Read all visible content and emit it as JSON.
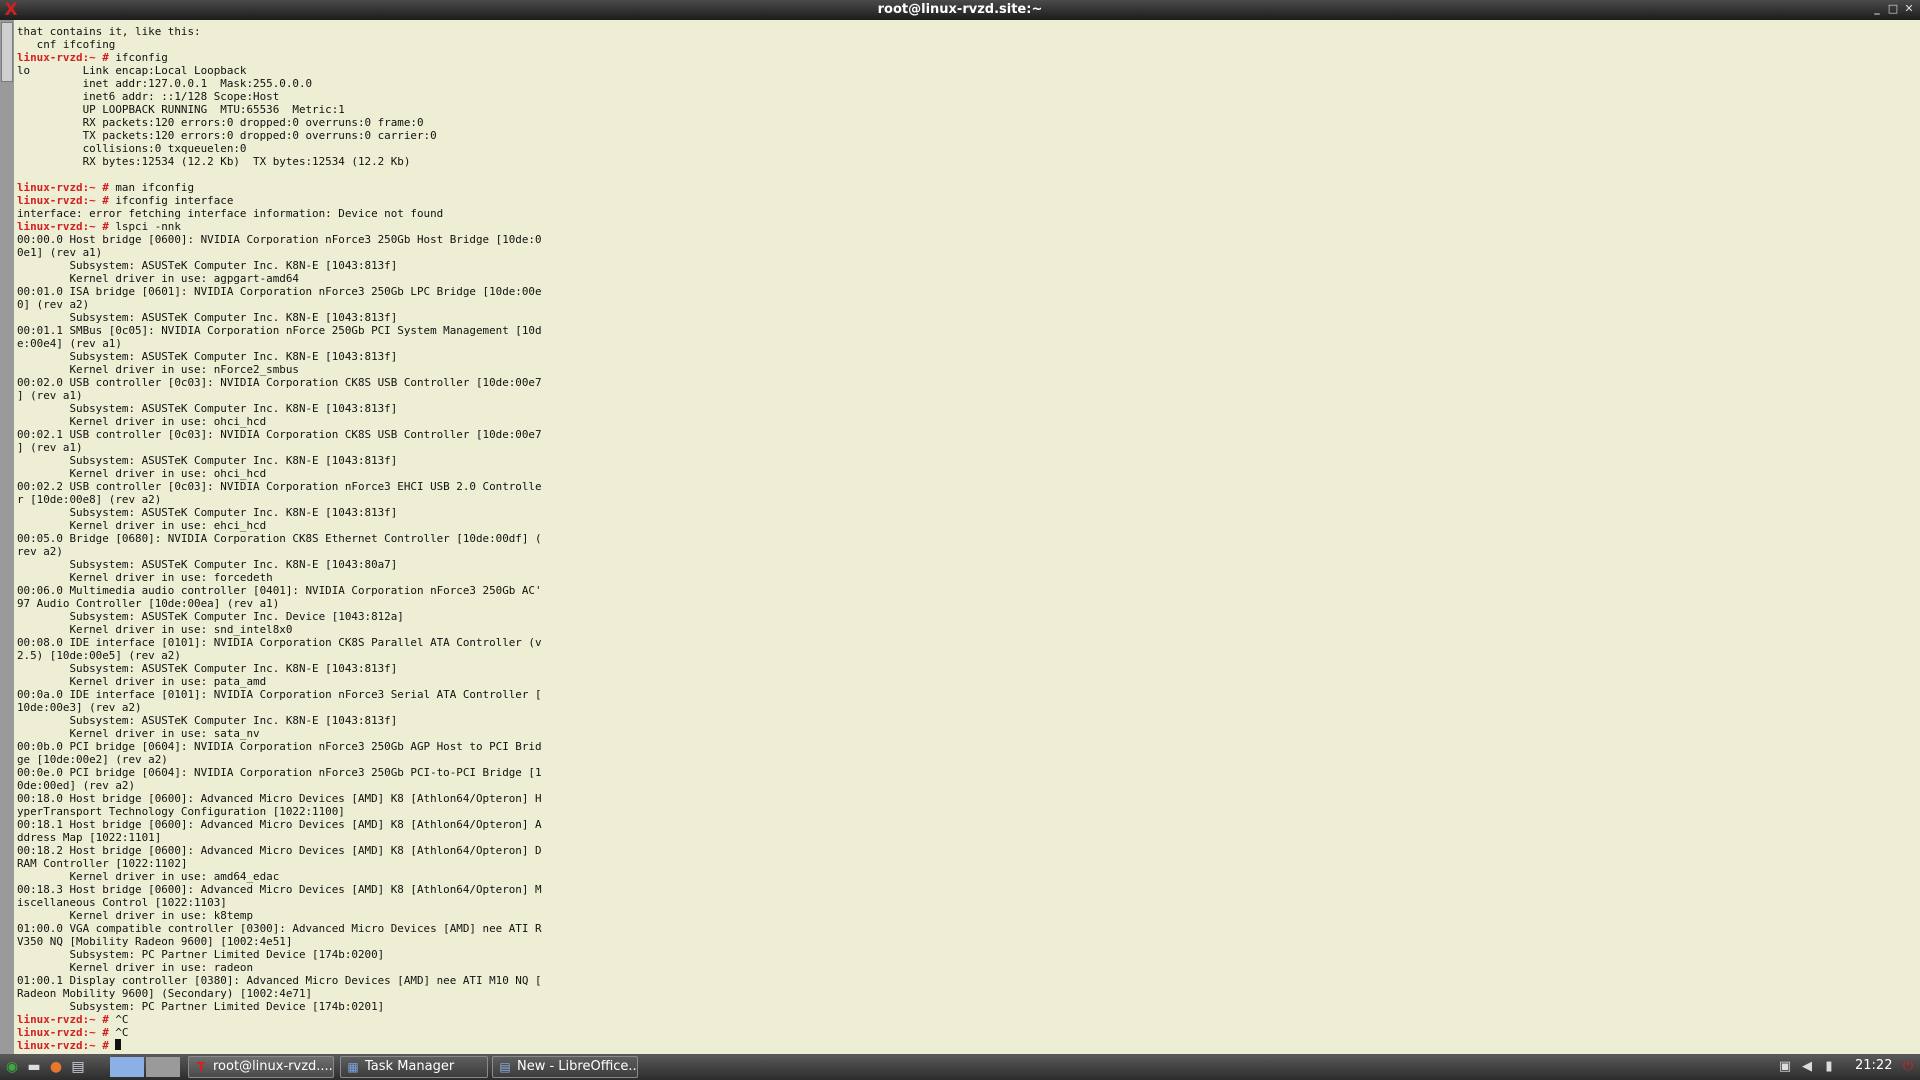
{
  "window": {
    "title": "root@linux-rvzd.site:~",
    "controls": [
      "minimize",
      "maximize",
      "close"
    ]
  },
  "terminal": {
    "lines": [
      {
        "text": "that contains it, like this:"
      },
      {
        "text": "   cnf ifcofing"
      },
      {
        "prompt": "linux-rvzd:~ #",
        "text": " ifconfig"
      },
      {
        "text": "lo        Link encap:Local Loopback"
      },
      {
        "text": "          inet addr:127.0.0.1  Mask:255.0.0.0"
      },
      {
        "text": "          inet6 addr: ::1/128 Scope:Host"
      },
      {
        "text": "          UP LOOPBACK RUNNING  MTU:65536  Metric:1"
      },
      {
        "text": "          RX packets:120 errors:0 dropped:0 overruns:0 frame:0"
      },
      {
        "text": "          TX packets:120 errors:0 dropped:0 overruns:0 carrier:0"
      },
      {
        "text": "          collisions:0 txqueuelen:0"
      },
      {
        "text": "          RX bytes:12534 (12.2 Kb)  TX bytes:12534 (12.2 Kb)"
      },
      {
        "text": ""
      },
      {
        "prompt": "linux-rvzd:~ #",
        "text": " man ifconfig"
      },
      {
        "prompt": "linux-rvzd:~ #",
        "text": " ifconfig interface"
      },
      {
        "text": "interface: error fetching interface information: Device not found"
      },
      {
        "prompt": "linux-rvzd:~ #",
        "text": " lspci -nnk"
      },
      {
        "text": "00:00.0 Host bridge [0600]: NVIDIA Corporation nForce3 250Gb Host Bridge [10de:0"
      },
      {
        "text": "0e1] (rev a1)"
      },
      {
        "text": "        Subsystem: ASUSTeK Computer Inc. K8N-E [1043:813f]"
      },
      {
        "text": "        Kernel driver in use: agpgart-amd64"
      },
      {
        "text": "00:01.0 ISA bridge [0601]: NVIDIA Corporation nForce3 250Gb LPC Bridge [10de:00e"
      },
      {
        "text": "0] (rev a2)"
      },
      {
        "text": "        Subsystem: ASUSTeK Computer Inc. K8N-E [1043:813f]"
      },
      {
        "text": "00:01.1 SMBus [0c05]: NVIDIA Corporation nForce 250Gb PCI System Management [10d"
      },
      {
        "text": "e:00e4] (rev a1)"
      },
      {
        "text": "        Subsystem: ASUSTeK Computer Inc. K8N-E [1043:813f]"
      },
      {
        "text": "        Kernel driver in use: nForce2_smbus"
      },
      {
        "text": "00:02.0 USB controller [0c03]: NVIDIA Corporation CK8S USB Controller [10de:00e7"
      },
      {
        "text": "] (rev a1)"
      },
      {
        "text": "        Subsystem: ASUSTeK Computer Inc. K8N-E [1043:813f]"
      },
      {
        "text": "        Kernel driver in use: ohci_hcd"
      },
      {
        "text": "00:02.1 USB controller [0c03]: NVIDIA Corporation CK8S USB Controller [10de:00e7"
      },
      {
        "text": "] (rev a1)"
      },
      {
        "text": "        Subsystem: ASUSTeK Computer Inc. K8N-E [1043:813f]"
      },
      {
        "text": "        Kernel driver in use: ohci_hcd"
      },
      {
        "text": "00:02.2 USB controller [0c03]: NVIDIA Corporation nForce3 EHCI USB 2.0 Controlle"
      },
      {
        "text": "r [10de:00e8] (rev a2)"
      },
      {
        "text": "        Subsystem: ASUSTeK Computer Inc. K8N-E [1043:813f]"
      },
      {
        "text": "        Kernel driver in use: ehci_hcd"
      },
      {
        "text": "00:05.0 Bridge [0680]: NVIDIA Corporation CK8S Ethernet Controller [10de:00df] ("
      },
      {
        "text": "rev a2)"
      },
      {
        "text": "        Subsystem: ASUSTeK Computer Inc. K8N-E [1043:80a7]"
      },
      {
        "text": "        Kernel driver in use: forcedeth"
      },
      {
        "text": "00:06.0 Multimedia audio controller [0401]: NVIDIA Corporation nForce3 250Gb AC'"
      },
      {
        "text": "97 Audio Controller [10de:00ea] (rev a1)"
      },
      {
        "text": "        Subsystem: ASUSTeK Computer Inc. Device [1043:812a]"
      },
      {
        "text": "        Kernel driver in use: snd_intel8x0"
      },
      {
        "text": "00:08.0 IDE interface [0101]: NVIDIA Corporation CK8S Parallel ATA Controller (v"
      },
      {
        "text": "2.5) [10de:00e5] (rev a2)"
      },
      {
        "text": "        Subsystem: ASUSTeK Computer Inc. K8N-E [1043:813f]"
      },
      {
        "text": "        Kernel driver in use: pata_amd"
      },
      {
        "text": "00:0a.0 IDE interface [0101]: NVIDIA Corporation nForce3 Serial ATA Controller ["
      },
      {
        "text": "10de:00e3] (rev a2)"
      },
      {
        "text": "        Subsystem: ASUSTeK Computer Inc. K8N-E [1043:813f]"
      },
      {
        "text": "        Kernel driver in use: sata_nv"
      },
      {
        "text": "00:0b.0 PCI bridge [0604]: NVIDIA Corporation nForce3 250Gb AGP Host to PCI Brid"
      },
      {
        "text": "ge [10de:00e2] (rev a2)"
      },
      {
        "text": "00:0e.0 PCI bridge [0604]: NVIDIA Corporation nForce3 250Gb PCI-to-PCI Bridge [1"
      },
      {
        "text": "0de:00ed] (rev a2)"
      },
      {
        "text": "00:18.0 Host bridge [0600]: Advanced Micro Devices [AMD] K8 [Athlon64/Opteron] H"
      },
      {
        "text": "yperTransport Technology Configuration [1022:1100]"
      },
      {
        "text": "00:18.1 Host bridge [0600]: Advanced Micro Devices [AMD] K8 [Athlon64/Opteron] A"
      },
      {
        "text": "ddress Map [1022:1101]"
      },
      {
        "text": "00:18.2 Host bridge [0600]: Advanced Micro Devices [AMD] K8 [Athlon64/Opteron] D"
      },
      {
        "text": "RAM Controller [1022:1102]"
      },
      {
        "text": "        Kernel driver in use: amd64_edac"
      },
      {
        "text": "00:18.3 Host bridge [0600]: Advanced Micro Devices [AMD] K8 [Athlon64/Opteron] M"
      },
      {
        "text": "iscellaneous Control [1022:1103]"
      },
      {
        "text": "        Kernel driver in use: k8temp"
      },
      {
        "text": "01:00.0 VGA compatible controller [0300]: Advanced Micro Devices [AMD] nee ATI R"
      },
      {
        "text": "V350 NQ [Mobility Radeon 9600] [1002:4e51]"
      },
      {
        "text": "        Subsystem: PC Partner Limited Device [174b:0200]"
      },
      {
        "text": "        Kernel driver in use: radeon"
      },
      {
        "text": "01:00.1 Display controller [0380]: Advanced Micro Devices [AMD] nee ATI M10 NQ ["
      },
      {
        "text": "Radeon Mobility 9600] (Secondary) [1002:4e71]"
      },
      {
        "text": "        Subsystem: PC Partner Limited Device [174b:0201]"
      },
      {
        "prompt": "linux-rvzd:~ #",
        "text": " ^C"
      },
      {
        "prompt": "linux-rvzd:~ #",
        "text": " ^C"
      },
      {
        "prompt": "linux-rvzd:~ #",
        "text": " ",
        "cursor": true
      }
    ]
  },
  "taskbar": {
    "launchers": [
      {
        "name": "start-menu-icon",
        "glyph": "◉",
        "color": "#3fa83f"
      },
      {
        "name": "terminal-launcher-icon",
        "glyph": "▬",
        "color": "#dddddd"
      },
      {
        "name": "firefox-icon",
        "glyph": "●",
        "color": "#e8772e"
      },
      {
        "name": "file-manager-icon",
        "glyph": "▤",
        "color": "#cfd8e6"
      }
    ],
    "desktops": [
      {
        "name": "desktop-1",
        "color": "#8ab0e6"
      },
      {
        "name": "desktop-2",
        "color": "#9a9a9a"
      }
    ],
    "tasks": [
      {
        "label": "root@linux-rvzd....",
        "icon": "terminal-icon",
        "glyph": "T",
        "icon_color": "#d42020",
        "active": true
      },
      {
        "label": "Task Manager",
        "icon": "task-manager-icon",
        "glyph": "▦",
        "icon_color": "#7aa6e0",
        "active": false
      },
      {
        "label": "New - LibreOffice...",
        "icon": "libreoffice-writer-icon",
        "glyph": "▤",
        "icon_color": "#8ab0e6",
        "active": false
      }
    ],
    "tray": [
      {
        "name": "clipboard-icon",
        "glyph": "▣"
      },
      {
        "name": "volume-icon",
        "glyph": "◀"
      },
      {
        "name": "network-icon",
        "glyph": "▮"
      }
    ],
    "clock": "21:22",
    "power_icon_color": "#d42020"
  },
  "colors": {
    "terminal_bg": "#eeeed4",
    "prompt": "#d42020",
    "text": "#111111"
  }
}
